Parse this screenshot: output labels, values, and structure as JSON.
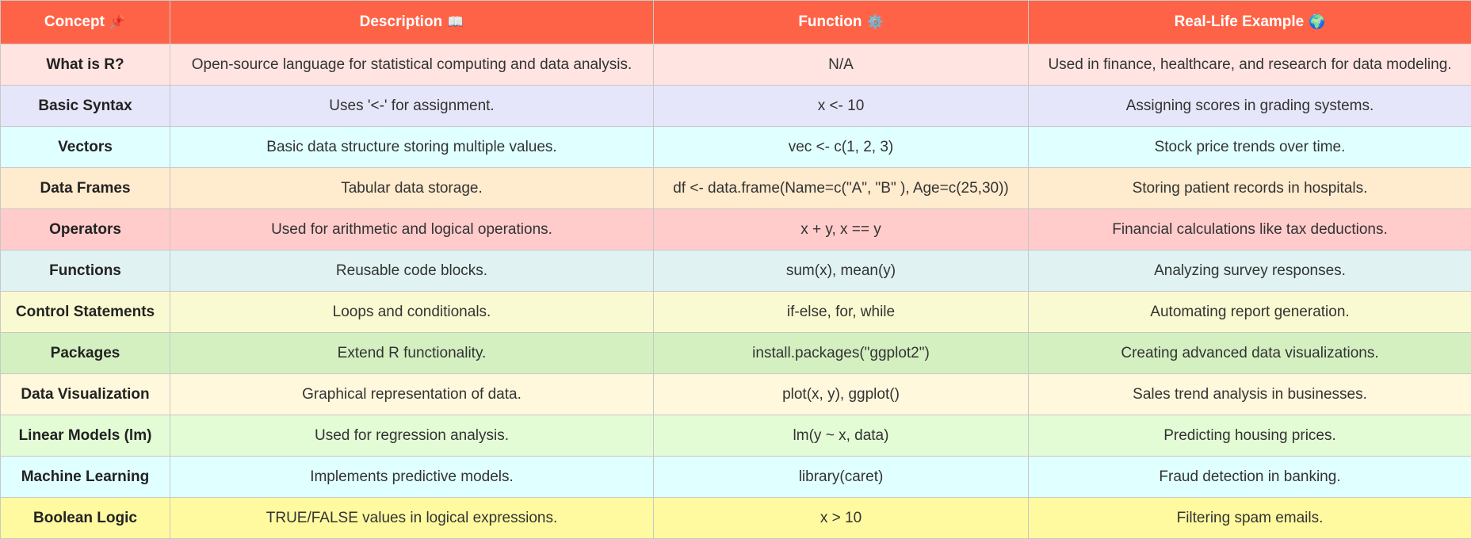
{
  "table": {
    "headers": [
      {
        "label": "Concept",
        "icon": "pushpin-icon",
        "glyph": "📌"
      },
      {
        "label": "Description",
        "icon": "book-icon",
        "glyph": "📖"
      },
      {
        "label": "Function",
        "icon": "gear-icon",
        "glyph": "⚙️"
      },
      {
        "label": "Real-Life Example",
        "icon": "globe-icon",
        "glyph": "🌍"
      }
    ],
    "header_color": "#ff6347",
    "rows": [
      {
        "concept": "What is R?",
        "description": "Open-source language for statistical computing and data analysis.",
        "function": "N/A",
        "example": "Used in finance, healthcare, and research for data modeling.",
        "color": "#ffe4e1"
      },
      {
        "concept": "Basic Syntax",
        "description": "Uses '<-' for assignment.",
        "function": "x <- 10",
        "example": "Assigning scores in grading systems.",
        "color": "#e6e6fa"
      },
      {
        "concept": "Vectors",
        "description": "Basic data structure storing multiple values.",
        "function": "vec <- c(1, 2, 3)",
        "example": "Stock price trends over time.",
        "color": "#e0ffff"
      },
      {
        "concept": "Data Frames",
        "description": "Tabular data storage.",
        "function": "df <- data.frame(Name=c(\"A\", \"B\" ), Age=c(25,30))",
        "example": "Storing patient records in hospitals.",
        "color": "#ffebcd"
      },
      {
        "concept": "Operators",
        "description": "Used for arithmetic and logical operations.",
        "function": "x + y, x == y",
        "example": "Financial calculations like tax deductions.",
        "color": "#ffcccb"
      },
      {
        "concept": "Functions",
        "description": "Reusable code blocks.",
        "function": "sum(x), mean(y)",
        "example": "Analyzing survey responses.",
        "color": "#e0f2f1"
      },
      {
        "concept": "Control Statements",
        "description": "Loops and conditionals.",
        "function": "if-else, for, while",
        "example": "Automating report generation.",
        "color": "#fafad2"
      },
      {
        "concept": "Packages",
        "description": "Extend R functionality.",
        "function": "install.packages(\"ggplot2\")",
        "example": "Creating advanced data visualizations.",
        "color": "#d4f0c0"
      },
      {
        "concept": "Data Visualization",
        "description": "Graphical representation of data.",
        "function": "plot(x, y), ggplot()",
        "example": "Sales trend analysis in businesses.",
        "color": "#fff8dc"
      },
      {
        "concept": "Linear Models (lm)",
        "description": "Used for regression analysis.",
        "function": "lm(y ~ x, data)",
        "example": "Predicting housing prices.",
        "color": "#e3fcd6"
      },
      {
        "concept": "Machine Learning",
        "description": "Implements predictive models.",
        "function": "library(caret)",
        "example": "Fraud detection in banking.",
        "color": "#e0ffff"
      },
      {
        "concept": "Boolean Logic",
        "description": "TRUE/FALSE values in logical expressions.",
        "function": "x > 10",
        "example": "Filtering spam emails.",
        "color": "#fffaa0"
      }
    ]
  }
}
